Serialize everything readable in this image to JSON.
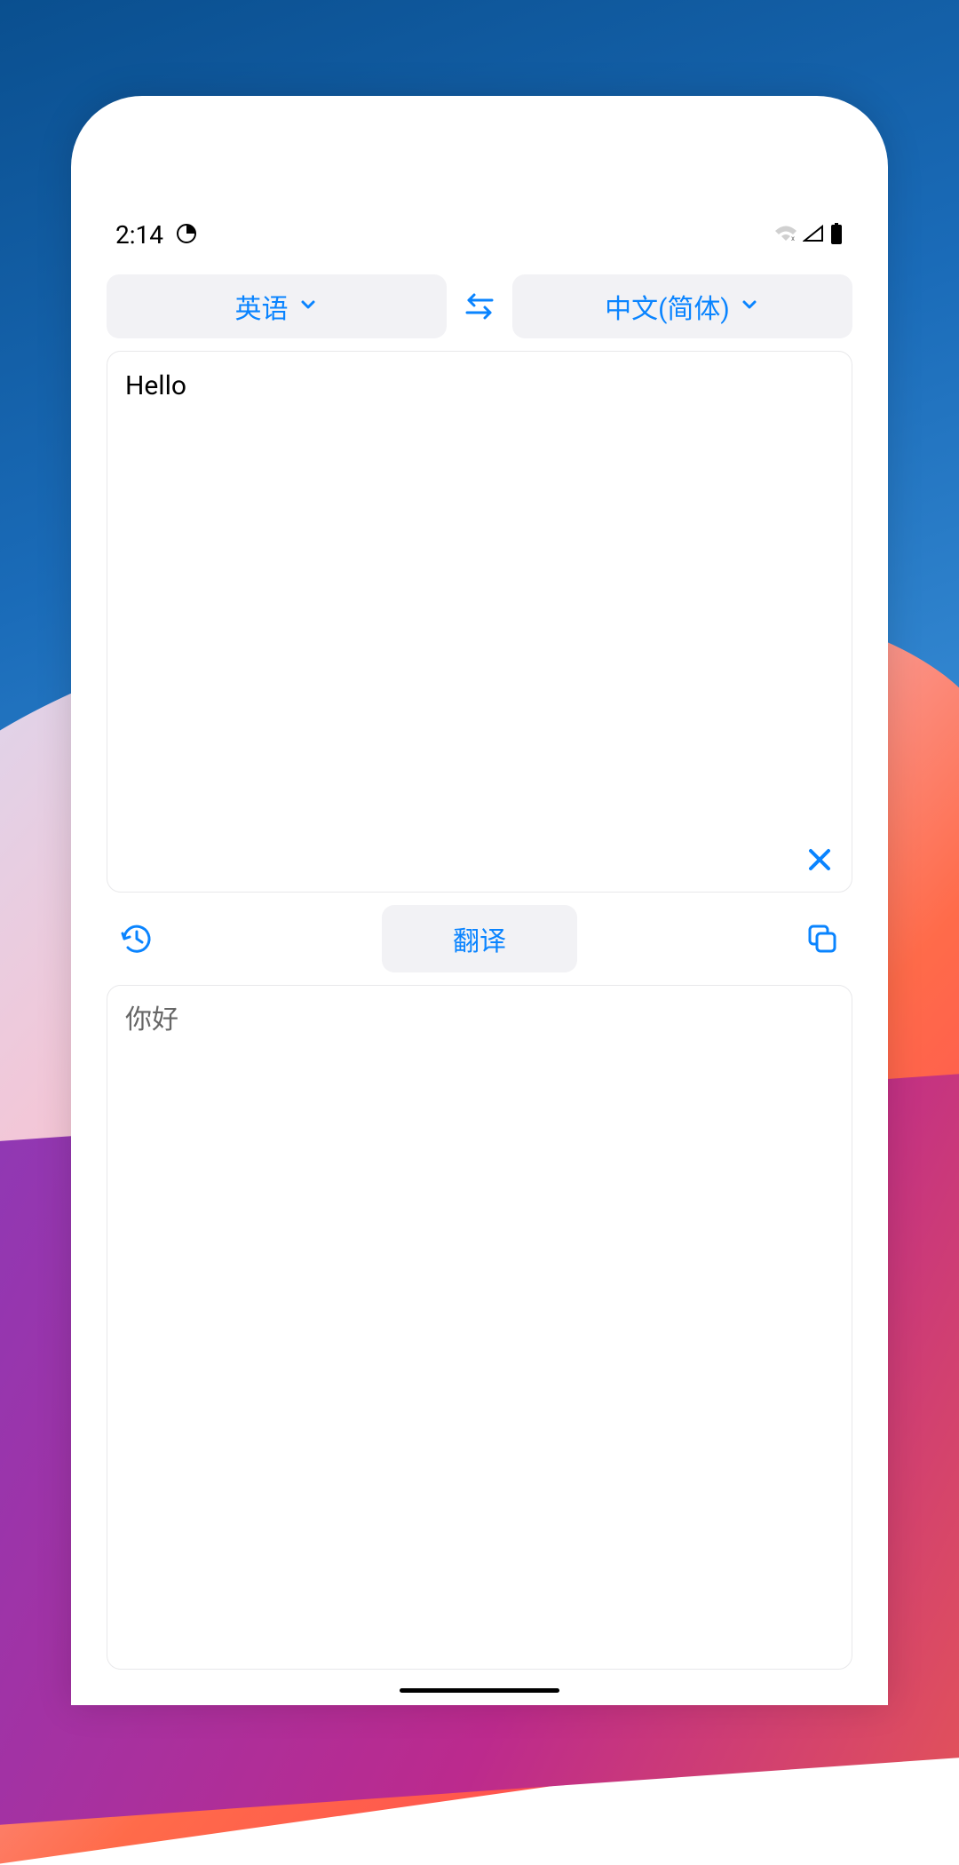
{
  "status_bar": {
    "time": "2:14"
  },
  "languages": {
    "source_label": "英语",
    "target_label": "中文(简体)"
  },
  "input": {
    "text": "Hello"
  },
  "actions": {
    "translate_label": "翻译"
  },
  "output": {
    "text": "你好"
  }
}
